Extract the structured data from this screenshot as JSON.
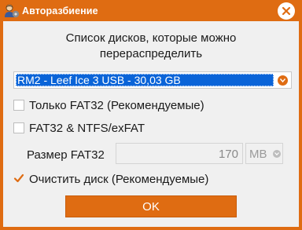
{
  "window": {
    "title": "Авторазбиение",
    "accent_color": "#df6c12",
    "app_icon": "user-gear-icon",
    "close_icon": "close-icon"
  },
  "heading": {
    "line1": "Список дисков, которые можно",
    "line2": "перераспределить"
  },
  "disk_select": {
    "selected": "RM2 - Leef Ice 3 USB - 30,03 GB",
    "arrow_icon": "chevron-down-icon"
  },
  "options": {
    "fat32_only": {
      "label": "Только FAT32 (Рекомендуемые)",
      "checked": false
    },
    "fat32_ntfs": {
      "label": "FAT32 & NTFS/exFAT",
      "checked": false
    },
    "clean_disk": {
      "label": "Очистить диск (Рекомендуемые)",
      "checked": true
    }
  },
  "fat32_size": {
    "label": "Размер FAT32",
    "value": "170",
    "unit": "MB",
    "enabled": false
  },
  "ok_button": {
    "label": "OK"
  }
}
